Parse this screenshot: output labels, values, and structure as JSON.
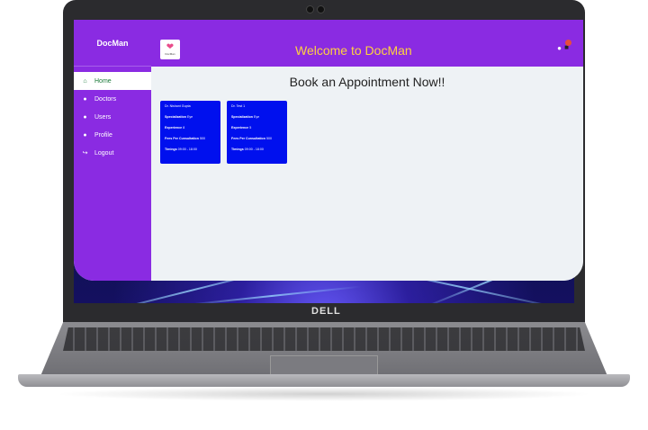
{
  "sidebar": {
    "brand": "DocMan",
    "items": [
      {
        "label": "Home",
        "icon": "home-icon"
      },
      {
        "label": "Doctors",
        "icon": "user-icon"
      },
      {
        "label": "Users",
        "icon": "user-icon"
      },
      {
        "label": "Profile",
        "icon": "user-icon"
      },
      {
        "label": "Logout",
        "icon": "logout-icon"
      }
    ]
  },
  "header": {
    "logo_text": "DocMan",
    "welcome": "Welcome to DocMan",
    "notification_icon": "bell-icon",
    "user_icon": "user-icon"
  },
  "main": {
    "title": "Book an Appointment Now!!",
    "doctors": [
      {
        "name": "Dr. Nishant Gupta",
        "specialization": "Eye",
        "experience": "8",
        "fees": "500",
        "timings": "09:00 - 18:00"
      },
      {
        "name": "Dr. Test 1",
        "specialization": "Eye",
        "experience": "5",
        "fees": "500",
        "timings": "09:00 - 18:00"
      }
    ],
    "labels": {
      "specialization": "Specialization",
      "experience": "Experience",
      "fees": "Fees Per Cunsultation",
      "timings": "Timings"
    }
  },
  "device": {
    "brand": "DELL"
  },
  "colors": {
    "sidebar": "#8a2be2",
    "welcome_text": "#ffd23f",
    "card": "#0010ee",
    "active_nav": "#1b7a3a"
  }
}
